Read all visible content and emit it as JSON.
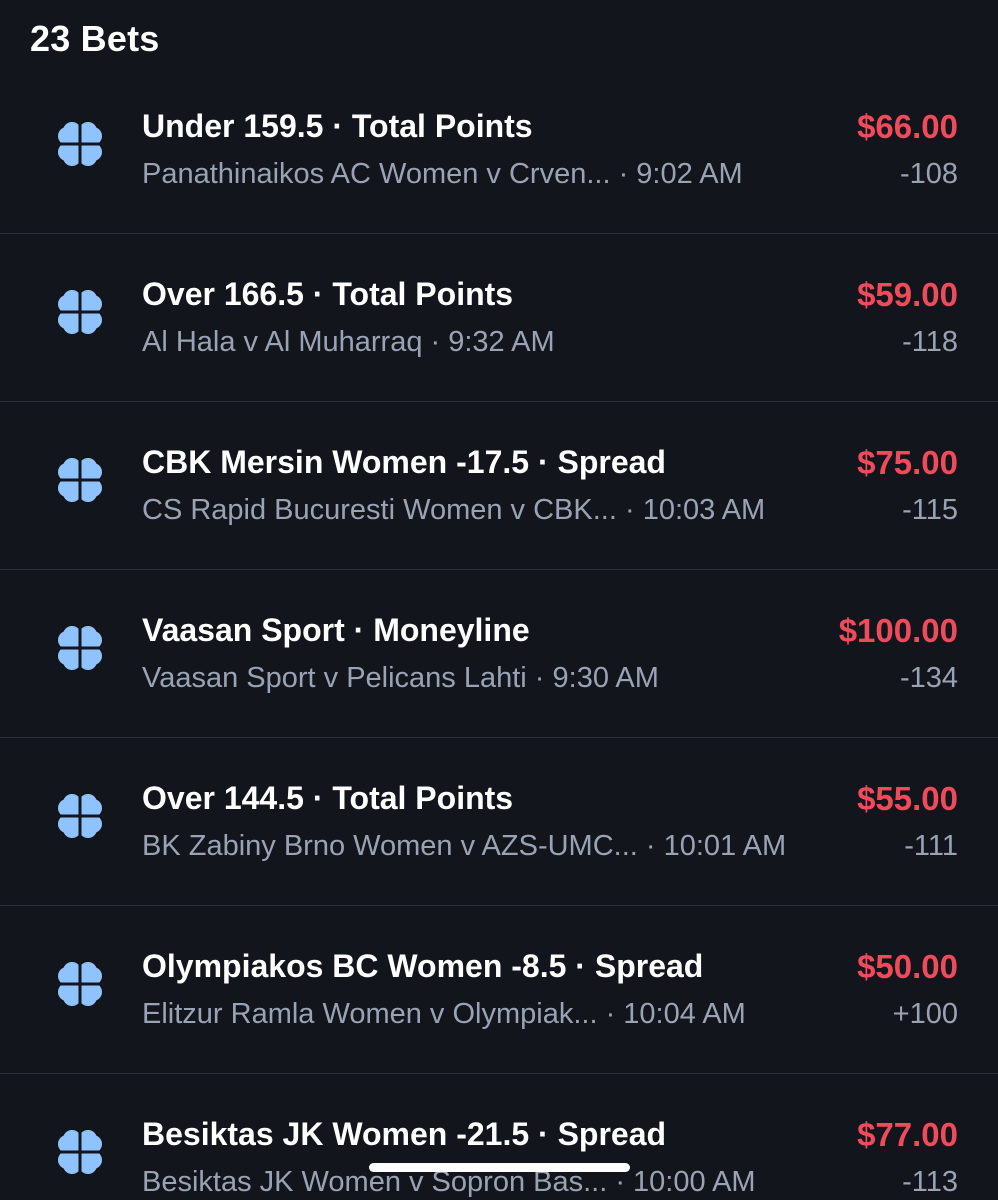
{
  "header": {
    "title": "23 Bets"
  },
  "colors": {
    "background": "#13151d",
    "amount": "#f04b5a",
    "secondary_text": "#9aa3b3",
    "icon": "#8fc3ff"
  },
  "icon_name": "clover-icon",
  "bets": [
    {
      "title": "Under 159.5 · Total Points",
      "subtitle": "Panathinaikos AC Women v Crven... · 9:02 AM",
      "amount": "$66.00",
      "odds": "-108"
    },
    {
      "title": "Over 166.5 · Total Points",
      "subtitle": "Al Hala v Al Muharraq · 9:32 AM",
      "amount": "$59.00",
      "odds": "-118"
    },
    {
      "title": "CBK Mersin Women -17.5 · Spread",
      "subtitle": "CS Rapid Bucuresti Women v CBK... · 10:03 AM",
      "amount": "$75.00",
      "odds": "-115"
    },
    {
      "title": "Vaasan Sport · Moneyline",
      "subtitle": "Vaasan Sport v Pelicans Lahti · 9:30 AM",
      "amount": "$100.00",
      "odds": "-134"
    },
    {
      "title": "Over 144.5 · Total Points",
      "subtitle": "BK Zabiny Brno Women v AZS-UMC... · 10:01 AM",
      "amount": "$55.00",
      "odds": "-111"
    },
    {
      "title": "Olympiakos BC Women -8.5 · Spread",
      "subtitle": "Elitzur Ramla Women v Olympiak... · 10:04 AM",
      "amount": "$50.00",
      "odds": "+100"
    },
    {
      "title": "Besiktas JK Women -21.5 · Spread",
      "subtitle": "Besiktas JK Women v Sopron Bas... · 10:00 AM",
      "amount": "$77.00",
      "odds": "-113"
    }
  ]
}
